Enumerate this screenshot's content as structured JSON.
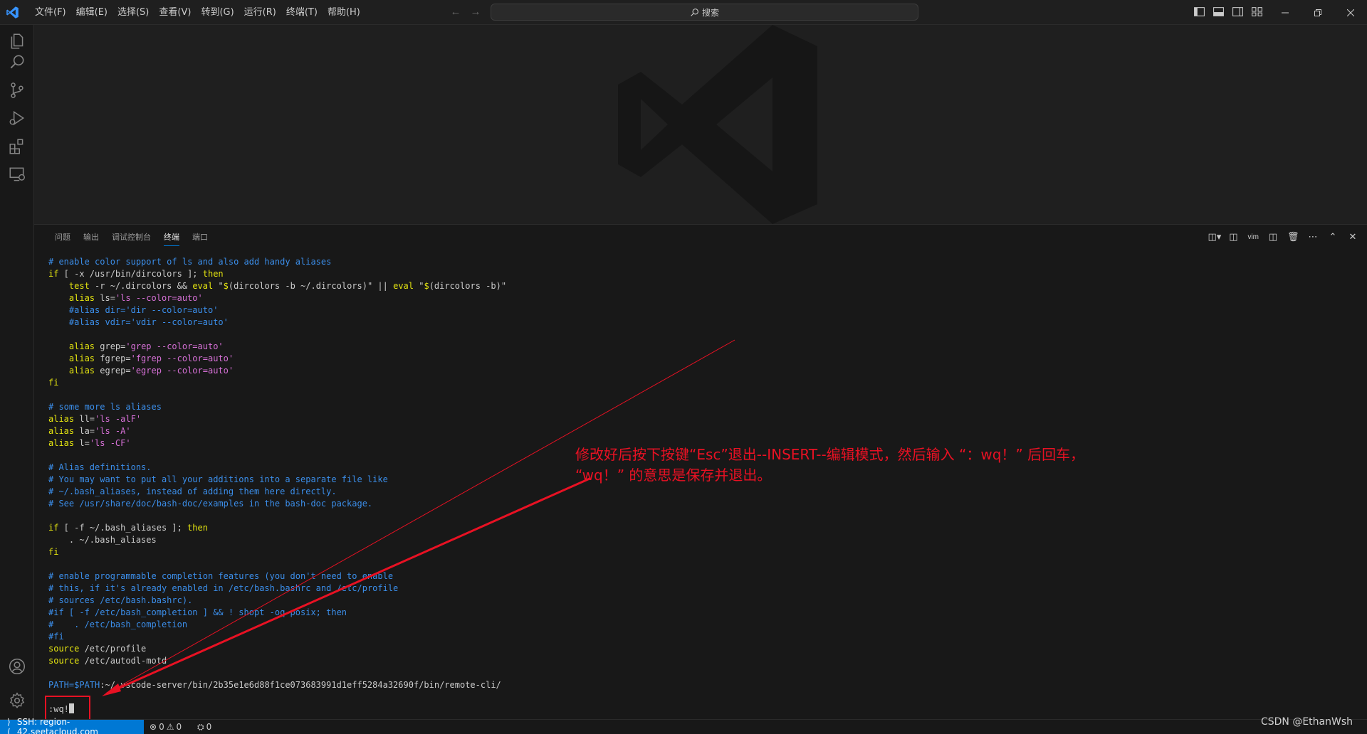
{
  "menu": [
    "文件(F)",
    "编辑(E)",
    "选择(S)",
    "查看(V)",
    "转到(G)",
    "运行(R)",
    "终端(T)",
    "帮助(H)"
  ],
  "search": {
    "label": "搜索"
  },
  "panel": {
    "tabs": [
      "问题",
      "输出",
      "调试控制台",
      "终端",
      "端口"
    ],
    "active_tab": "终端",
    "shell_label": "vim"
  },
  "terminal_lines": [
    [
      [
        "c",
        "# enable color support of ls and also add handy aliases"
      ]
    ],
    [
      [
        "k",
        "if"
      ],
      [
        "p",
        " [ -x /usr/bin/dircolors ]; "
      ],
      [
        "k",
        "then"
      ]
    ],
    [
      [
        "p",
        "    "
      ],
      [
        "k",
        "test"
      ],
      [
        "p",
        " -r ~/.dircolors && "
      ],
      [
        "k",
        "eval"
      ],
      [
        "p",
        " \""
      ],
      [
        "k",
        "$"
      ],
      [
        "p",
        "(dircolors -b ~/.dircolors)\" || "
      ],
      [
        "k",
        "eval"
      ],
      [
        "p",
        " \""
      ],
      [
        "k",
        "$"
      ],
      [
        "p",
        "(dircolors -b)\""
      ]
    ],
    [
      [
        "p",
        "    "
      ],
      [
        "k",
        "alias"
      ],
      [
        "p",
        " ls="
      ],
      [
        "s",
        "'ls --color=auto'"
      ]
    ],
    [
      [
        "c",
        "    #alias dir='dir --color=auto'"
      ]
    ],
    [
      [
        "c",
        "    #alias vdir='vdir --color=auto'"
      ]
    ],
    [],
    [
      [
        "p",
        "    "
      ],
      [
        "k",
        "alias"
      ],
      [
        "p",
        " grep="
      ],
      [
        "s",
        "'grep --color=auto'"
      ]
    ],
    [
      [
        "p",
        "    "
      ],
      [
        "k",
        "alias"
      ],
      [
        "p",
        " fgrep="
      ],
      [
        "s",
        "'fgrep --color=auto'"
      ]
    ],
    [
      [
        "p",
        "    "
      ],
      [
        "k",
        "alias"
      ],
      [
        "p",
        " egrep="
      ],
      [
        "s",
        "'egrep --color=auto'"
      ]
    ],
    [
      [
        "k",
        "fi"
      ]
    ],
    [],
    [
      [
        "c",
        "# some more ls aliases"
      ]
    ],
    [
      [
        "k",
        "alias"
      ],
      [
        "p",
        " ll="
      ],
      [
        "s",
        "'ls -alF'"
      ]
    ],
    [
      [
        "k",
        "alias"
      ],
      [
        "p",
        " la="
      ],
      [
        "s",
        "'ls -A'"
      ]
    ],
    [
      [
        "k",
        "alias"
      ],
      [
        "p",
        " l="
      ],
      [
        "s",
        "'ls -CF'"
      ]
    ],
    [],
    [
      [
        "c",
        "# Alias definitions."
      ]
    ],
    [
      [
        "c",
        "# You may want to put all your additions into a separate file like"
      ]
    ],
    [
      [
        "c",
        "# ~/.bash_aliases, instead of adding them here directly."
      ]
    ],
    [
      [
        "c",
        "# See /usr/share/doc/bash-doc/examples in the bash-doc package."
      ]
    ],
    [],
    [
      [
        "k",
        "if"
      ],
      [
        "p",
        " [ -f ~/.bash_aliases ]; "
      ],
      [
        "k",
        "then"
      ]
    ],
    [
      [
        "p",
        "    . ~/.bash_aliases"
      ]
    ],
    [
      [
        "k",
        "fi"
      ]
    ],
    [],
    [
      [
        "c",
        "# enable programmable completion features (you don't need to enable"
      ]
    ],
    [
      [
        "c",
        "# this, if it's already enabled in /etc/bash.bashrc and /etc/profile"
      ]
    ],
    [
      [
        "c",
        "# sources /etc/bash.bashrc)."
      ]
    ],
    [
      [
        "c",
        "#if [ -f /etc/bash_completion ] && ! shopt -oq posix; then"
      ]
    ],
    [
      [
        "c",
        "#    . /etc/bash_completion"
      ]
    ],
    [
      [
        "c",
        "#fi"
      ]
    ],
    [
      [
        "k",
        "source"
      ],
      [
        "p",
        " /etc/profile"
      ]
    ],
    [
      [
        "k",
        "source"
      ],
      [
        "p",
        " /etc/autodl-motd"
      ]
    ],
    [],
    [
      [
        "v",
        "PATH=$PATH"
      ],
      [
        "p",
        ":~/.vscode-server/bin/2b35e1e6d88f1ce073683991d1eff5284a32690f/bin/remote-cli/"
      ]
    ],
    []
  ],
  "command_line": ":wq!",
  "annotation": {
    "line1": "修改好后按下按键“Esc”退出--INSERT--编辑模式，然后输入 “：wq！” 后回车，",
    "line2": "“wq！” 的意思是保存并退出。",
    "color": "#e81123"
  },
  "statusbar": {
    "remote": "SSH: region-42.seetacloud.com",
    "errors": "0",
    "warnings": "0",
    "ports": "0"
  },
  "credit": "CSDN @EthanWsh",
  "colors": {
    "accent": "#0078d4",
    "keyword": "#e5e510",
    "comment": "#3b8eea",
    "string": "#d670d6"
  }
}
